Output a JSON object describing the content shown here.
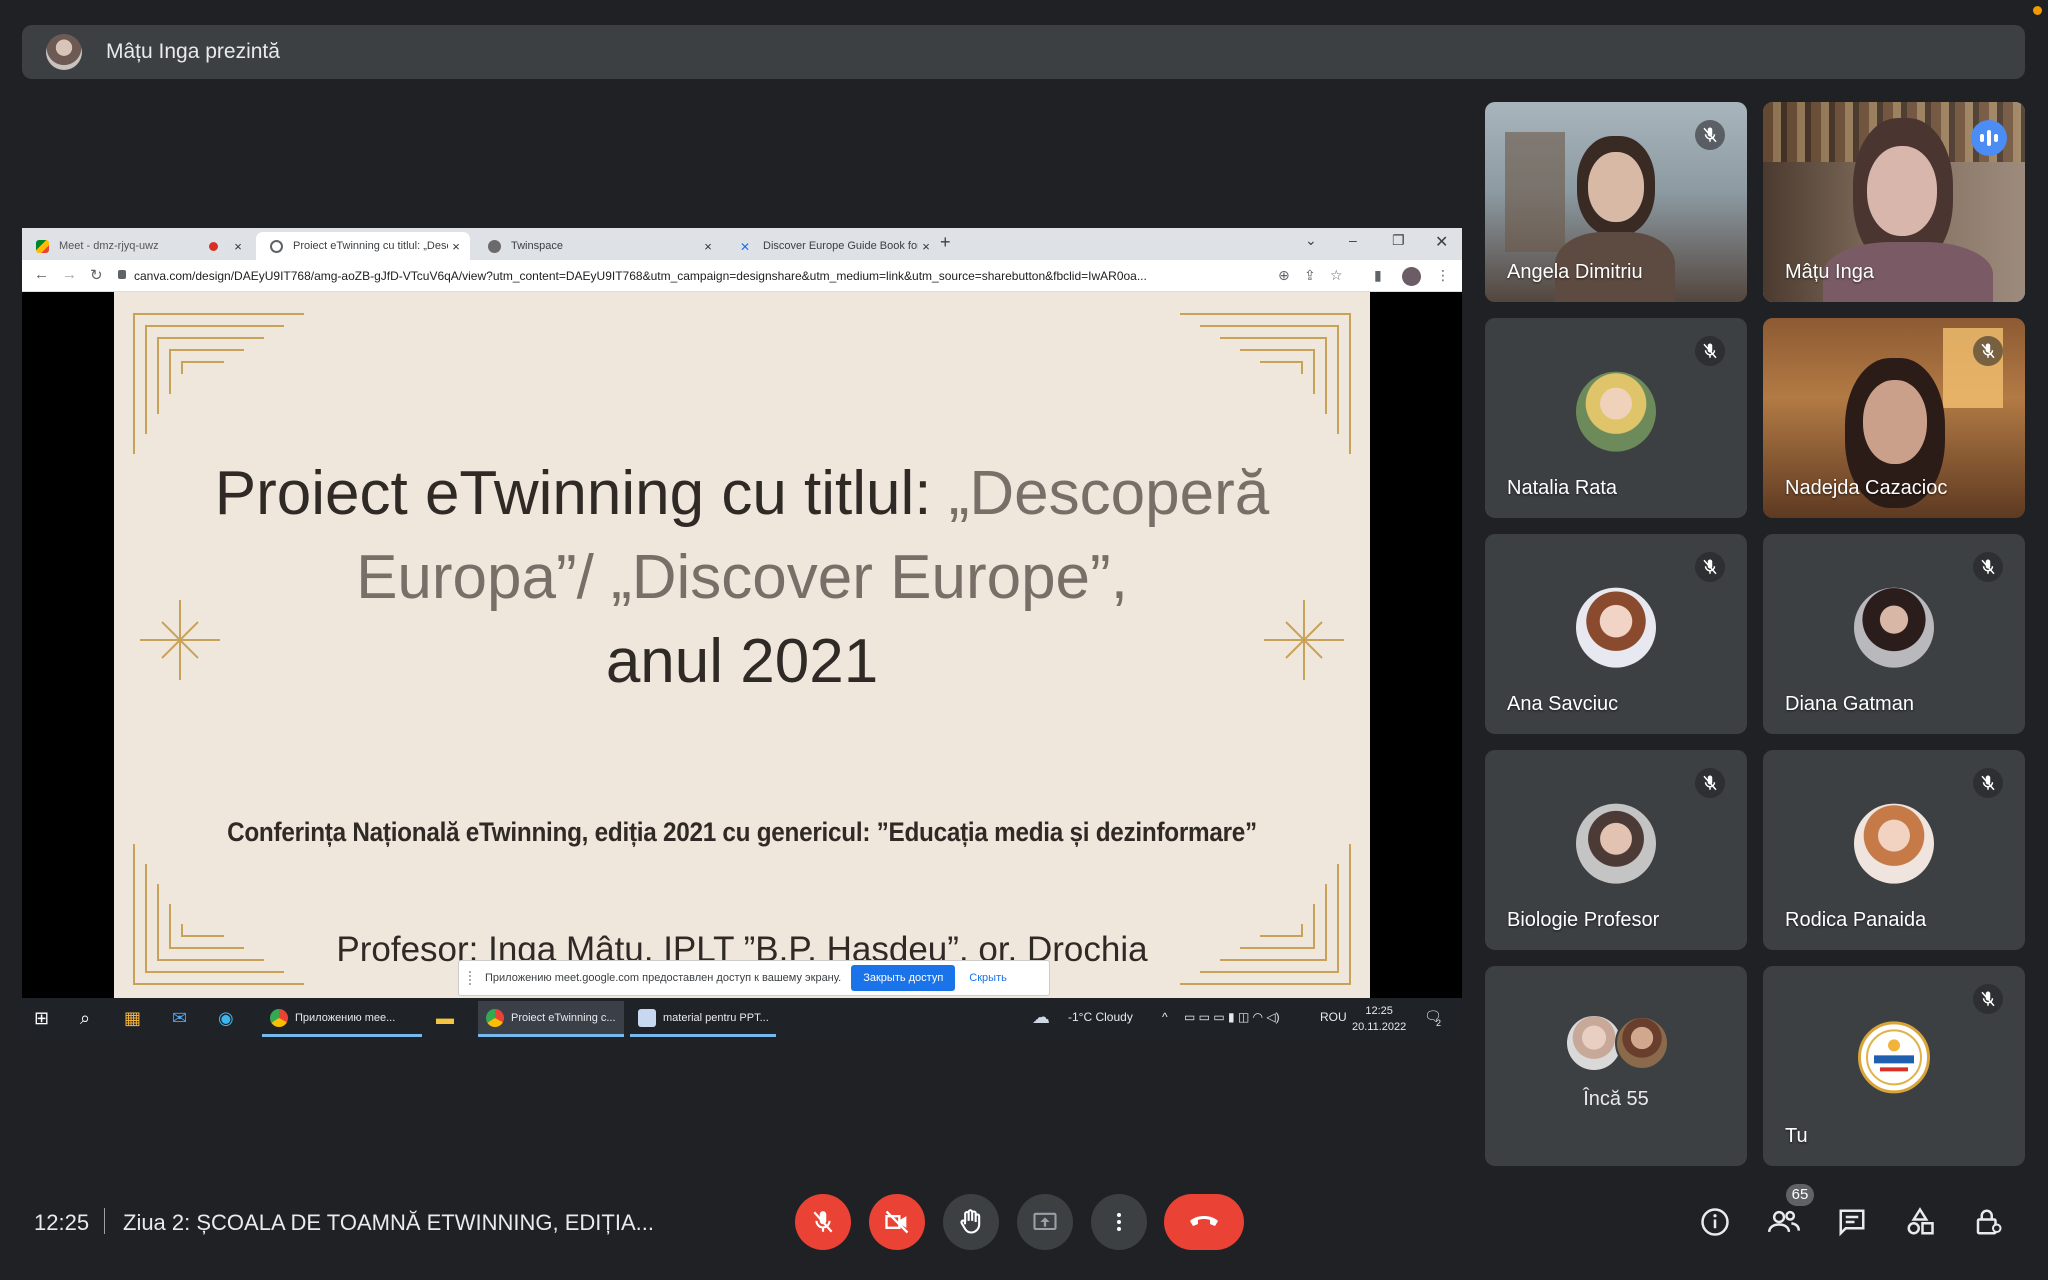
{
  "presenter": {
    "text": "Mâțu Inga prezintă"
  },
  "browser": {
    "tabs": [
      {
        "label": "Meet - dmz-rjyq-uwz",
        "favicon": "meet-icon"
      },
      {
        "label": "Proiect eTwinning cu titlul: „Desc",
        "favicon": "canva-icon",
        "active": true
      },
      {
        "label": "Twinspace",
        "favicon": "twinspace-icon"
      },
      {
        "label": "Discover Europe Guide Book for",
        "favicon": "doc-icon"
      }
    ],
    "url": "canva.com/design/DAEyU9IT768/amg-aoZB-gJfD-VTcuV6qA/view?utm_content=DAEyU9IT768&utm_campaign=designshare&utm_medium=link&utm_source=sharebutton&fbclid=IwAR0oa..."
  },
  "slide": {
    "title_line1_a": "Proiect eTwinning cu titlul: ",
    "title_line1_b": "„Descoperă",
    "title_line2": "Europa”/ „Discover Europe”,",
    "title_line3": "anul 2021",
    "subtitle": "Conferința Națională eTwinning, ediția 2021 cu genericul: ”Educația media și dezinformare”",
    "author": "Profesor: Inga Mâțu, IPLT ”B.P. Hasdeu”, or. Drochia"
  },
  "share_notice": {
    "text": "Приложению meet.google.com предоставлен доступ к вашему экрану.",
    "stop_label": "Закрыть доступ",
    "hide_label": "Скрыть"
  },
  "taskbar": {
    "apps": [
      {
        "label": "Приложению mee..."
      },
      {
        "label": "Proiect eTwinning c..."
      },
      {
        "label": "material pentru PPT..."
      }
    ],
    "weather": "-1°C  Cloudy",
    "lang": "ROU",
    "time": "12:25",
    "date": "20.11.2022",
    "notif_count": "2"
  },
  "participants": [
    {
      "name": "Angela Dimitriu"
    },
    {
      "name": "Mâțu Inga"
    },
    {
      "name": "Natalia Rata"
    },
    {
      "name": "Nadejda Cazacioc"
    },
    {
      "name": "Ana Savciuc"
    },
    {
      "name": "Diana Gatman"
    },
    {
      "name": "Biologie Profesor"
    },
    {
      "name": "Rodica Panaida"
    },
    {
      "name": "Încă 55"
    },
    {
      "name": "Tu"
    }
  ],
  "bottom": {
    "time": "12:25",
    "meeting_title": "Ziua 2: ȘCOALA DE TOAMNĂ ETWINNING, EDIȚIA...",
    "people_count": "65"
  },
  "colors": {
    "background": "#202124",
    "tile": "#3c4043",
    "danger": "#ea4335",
    "accent": "#8ab4f8"
  }
}
